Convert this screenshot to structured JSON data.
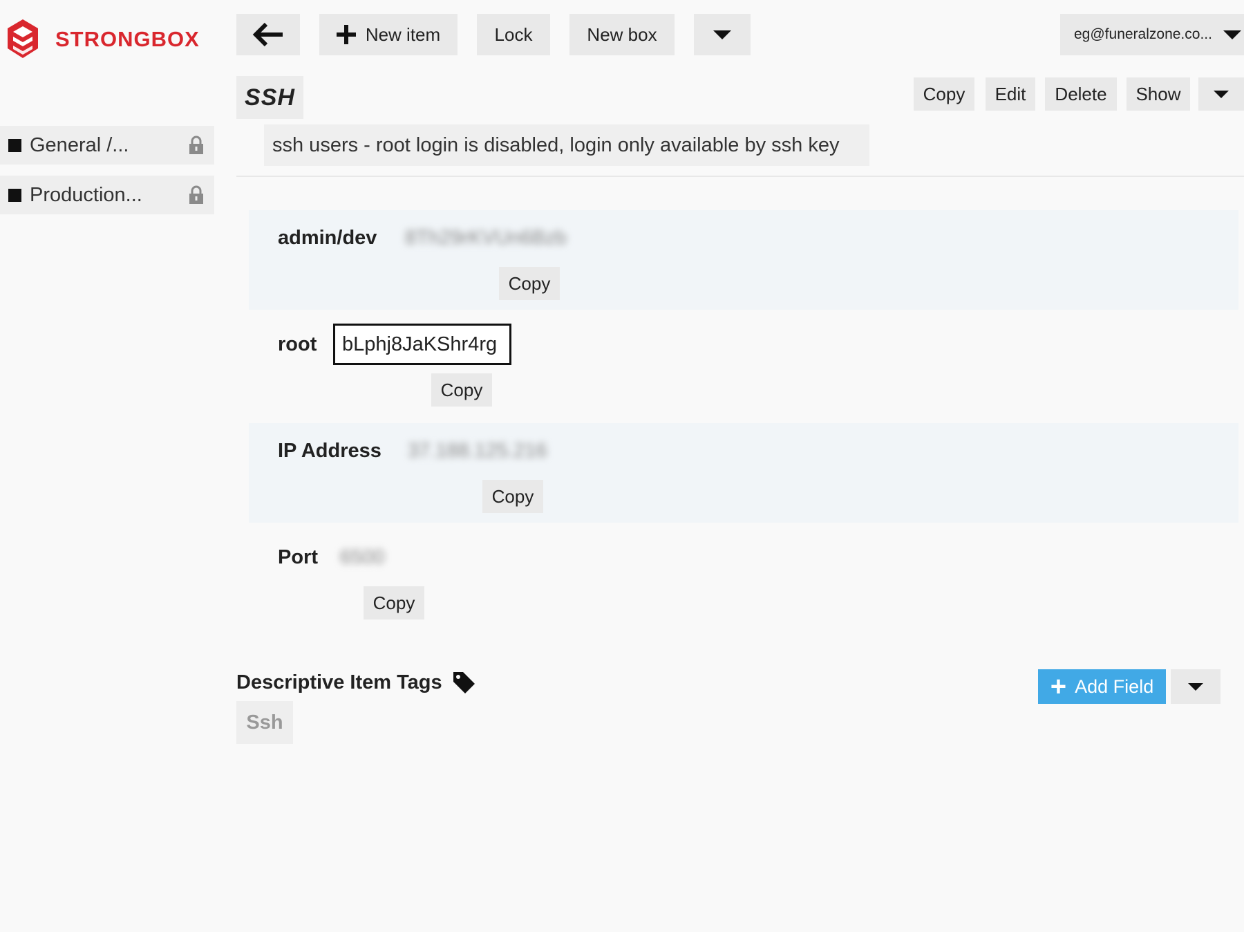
{
  "app": {
    "name": "STRONGBOX",
    "brand_color": "#d9272e"
  },
  "toolbar": {
    "back_icon": "arrow-left-icon",
    "new_item": "New item",
    "lock": "Lock",
    "new_box": "New box",
    "account": "eg@funeralzone.co..."
  },
  "sidebar": {
    "items": [
      {
        "label": "General /...",
        "icon": "lock-icon"
      },
      {
        "label": "Production...",
        "icon": "lock-icon"
      }
    ]
  },
  "item": {
    "title": "SSH",
    "description": "ssh users - root login is disabled, login only available by ssh key",
    "actions": {
      "copy": "Copy",
      "edit": "Edit",
      "delete": "Delete",
      "show": "Show"
    },
    "fields": [
      {
        "label": "admin/dev",
        "value": "8Th29rKVUn6Bzb",
        "copy": "Copy",
        "blurred": true
      },
      {
        "label": "root",
        "value": "bLphj8JaKShr4rg",
        "copy": "Copy",
        "blurred": false
      },
      {
        "label": "IP Address",
        "value": "37.188.125.216",
        "copy": "Copy",
        "blurred": true
      },
      {
        "label": "Port",
        "value": "6500",
        "copy": "Copy",
        "blurred": true
      }
    ]
  },
  "tags": {
    "heading": "Descriptive Item Tags",
    "icon": "tag-icon",
    "items": [
      "Ssh"
    ]
  },
  "add_field": {
    "label": "Add Field",
    "color": "#41a9e6"
  }
}
